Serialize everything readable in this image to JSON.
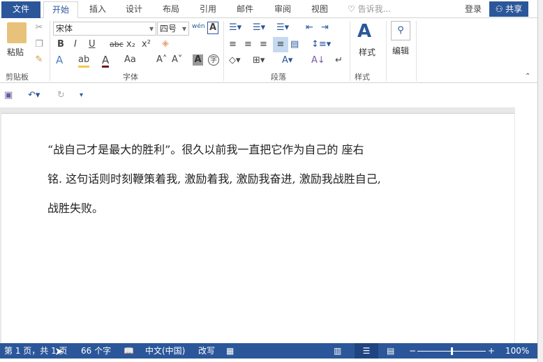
{
  "tabs": {
    "file": "文件",
    "items": [
      "开始",
      "插入",
      "设计",
      "布局",
      "引用",
      "邮件",
      "审阅",
      "视图"
    ],
    "tell_me": "告诉我...",
    "signin": "登录",
    "share": "共享"
  },
  "ribbon": {
    "clipboard": {
      "paste": "粘贴",
      "label": "剪贴板"
    },
    "font": {
      "name": "宋体",
      "size": "四号",
      "label": "字体",
      "bold": "B",
      "italic": "I",
      "underline": "U",
      "strike": "abc",
      "sub": "x₂",
      "sup": "x²",
      "case": "Aa",
      "phonetic": "wén"
    },
    "paragraph": {
      "label": "段落"
    },
    "styles": {
      "button": "样式",
      "label": "样式"
    },
    "editing": {
      "button": "编辑"
    }
  },
  "document": {
    "lines": [
      "“战自己才是最大的胜利”。很久以前我一直把它作为自己的  座右",
      "铭.   这句话则时刻鞭策着我, 激励着我, 激励我奋进, 激励我战胜自己,",
      "战胜失败。"
    ]
  },
  "status": {
    "page": "第 1 页，共 1 页",
    "words": "66 个字",
    "language": "中文(中国)",
    "mode": "改写",
    "zoom": "100%",
    "zoom_level": 100
  },
  "colors": {
    "accent": "#2b579a"
  }
}
